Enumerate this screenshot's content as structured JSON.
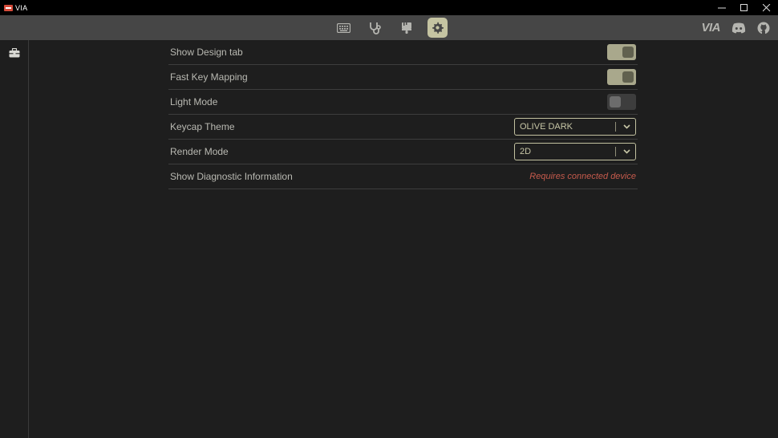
{
  "window": {
    "title": "VIA",
    "controls": {
      "minimize": "—",
      "maximize": "☐",
      "close": "✕"
    }
  },
  "topbar": {
    "nav": [
      {
        "name": "keyboard-icon",
        "active": false
      },
      {
        "name": "stethoscope-icon",
        "active": false
      },
      {
        "name": "design-brush-icon",
        "active": false
      },
      {
        "name": "gear-icon",
        "active": true
      }
    ],
    "brand": "VIA"
  },
  "settings": {
    "rows": [
      {
        "label": "Show Design tab",
        "type": "toggle",
        "state": "on"
      },
      {
        "label": "Fast Key Mapping",
        "type": "toggle",
        "state": "on"
      },
      {
        "label": "Light Mode",
        "type": "toggle",
        "state": "off"
      },
      {
        "label": "Keycap Theme",
        "type": "select",
        "value": "OLIVE DARK"
      },
      {
        "label": "Render Mode",
        "type": "select",
        "value": "2D"
      },
      {
        "label": "Show Diagnostic Information",
        "type": "text",
        "value": "Requires connected device"
      }
    ]
  },
  "colors": {
    "accent": "#c5c4a2",
    "warning": "#c55a4c",
    "background": "#1e1e1e",
    "topbar": "#464646"
  }
}
